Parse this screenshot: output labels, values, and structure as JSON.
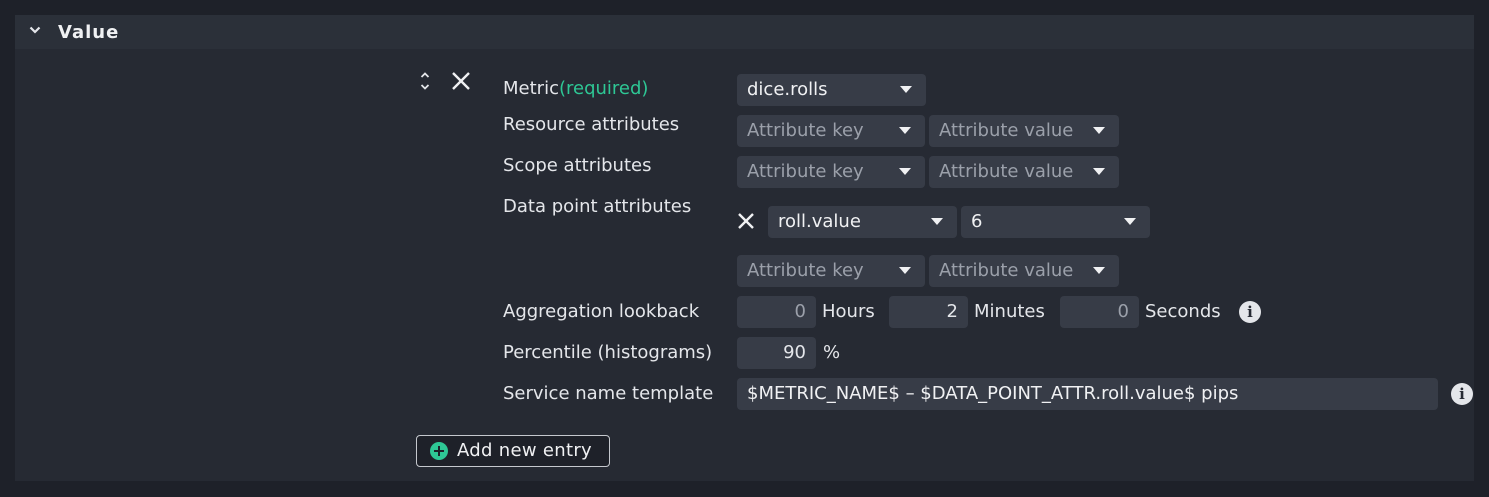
{
  "panel": {
    "title": "Value"
  },
  "entry": {
    "metric": {
      "label": "Metric",
      "required_suffix": "(required)",
      "value": "dice.rolls"
    },
    "resource_attributes": {
      "label": "Resource attributes",
      "key_placeholder": "Attribute key",
      "value_placeholder": "Attribute value"
    },
    "scope_attributes": {
      "label": "Scope attributes",
      "key_placeholder": "Attribute key",
      "value_placeholder": "Attribute value"
    },
    "data_point_attributes": {
      "label": "Data point attributes",
      "rows": [
        {
          "key": "roll.value",
          "value": "6"
        }
      ],
      "key_placeholder": "Attribute key",
      "value_placeholder": "Attribute value"
    },
    "aggregation_lookback": {
      "label": "Aggregation lookback",
      "hours": "0",
      "hours_unit": "Hours",
      "minutes": "2",
      "minutes_unit": "Minutes",
      "seconds": "0",
      "seconds_unit": "Seconds"
    },
    "percentile": {
      "label": "Percentile (histograms)",
      "value": "90",
      "unit": "%"
    },
    "service_name_template": {
      "label": "Service name template",
      "value": "$METRIC_NAME$ – $DATA_POINT_ATTR.roll.value$ pips"
    }
  },
  "actions": {
    "add_new_entry": "Add new entry"
  },
  "icons": {
    "collapse": "chevron-down-icon",
    "reorder": "reorder-icon",
    "remove": "close-icon",
    "info": "info-icon",
    "add": "plus-circle-icon"
  },
  "colors": {
    "accent": "#2ec795",
    "background": "#1e2129",
    "panel": "#262a33",
    "input": "#373c47"
  }
}
